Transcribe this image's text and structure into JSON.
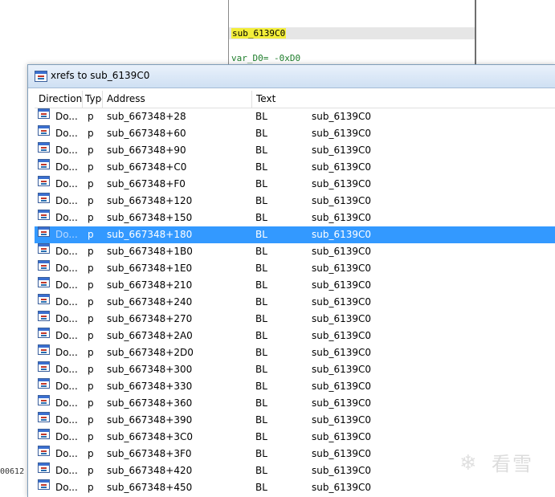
{
  "background": {
    "function_name": "sub_6139C0",
    "var_line": "var_D0= -0xD0",
    "status_text": "00612"
  },
  "window": {
    "title": "xrefs to sub_6139C0",
    "icon": "xref-window-icon"
  },
  "columns": {
    "direction": "Direction",
    "type": "Type",
    "address": "Address",
    "text": "Text"
  },
  "rows": [
    {
      "direction": "Do...",
      "type": "p",
      "address": "sub_667348+28",
      "instruction": "BL",
      "operand": "sub_6139C0"
    },
    {
      "direction": "Do...",
      "type": "p",
      "address": "sub_667348+60",
      "instruction": "BL",
      "operand": "sub_6139C0"
    },
    {
      "direction": "Do...",
      "type": "p",
      "address": "sub_667348+90",
      "instruction": "BL",
      "operand": "sub_6139C0"
    },
    {
      "direction": "Do...",
      "type": "p",
      "address": "sub_667348+C0",
      "instruction": "BL",
      "operand": "sub_6139C0"
    },
    {
      "direction": "Do...",
      "type": "p",
      "address": "sub_667348+F0",
      "instruction": "BL",
      "operand": "sub_6139C0"
    },
    {
      "direction": "Do...",
      "type": "p",
      "address": "sub_667348+120",
      "instruction": "BL",
      "operand": "sub_6139C0"
    },
    {
      "direction": "Do...",
      "type": "p",
      "address": "sub_667348+150",
      "instruction": "BL",
      "operand": "sub_6139C0"
    },
    {
      "direction": "Do...",
      "type": "p",
      "address": "sub_667348+180",
      "instruction": "BL",
      "operand": "sub_6139C0",
      "selected": true
    },
    {
      "direction": "Do...",
      "type": "p",
      "address": "sub_667348+1B0",
      "instruction": "BL",
      "operand": "sub_6139C0"
    },
    {
      "direction": "Do...",
      "type": "p",
      "address": "sub_667348+1E0",
      "instruction": "BL",
      "operand": "sub_6139C0"
    },
    {
      "direction": "Do...",
      "type": "p",
      "address": "sub_667348+210",
      "instruction": "BL",
      "operand": "sub_6139C0"
    },
    {
      "direction": "Do...",
      "type": "p",
      "address": "sub_667348+240",
      "instruction": "BL",
      "operand": "sub_6139C0"
    },
    {
      "direction": "Do...",
      "type": "p",
      "address": "sub_667348+270",
      "instruction": "BL",
      "operand": "sub_6139C0"
    },
    {
      "direction": "Do...",
      "type": "p",
      "address": "sub_667348+2A0",
      "instruction": "BL",
      "operand": "sub_6139C0"
    },
    {
      "direction": "Do...",
      "type": "p",
      "address": "sub_667348+2D0",
      "instruction": "BL",
      "operand": "sub_6139C0"
    },
    {
      "direction": "Do...",
      "type": "p",
      "address": "sub_667348+300",
      "instruction": "BL",
      "operand": "sub_6139C0"
    },
    {
      "direction": "Do...",
      "type": "p",
      "address": "sub_667348+330",
      "instruction": "BL",
      "operand": "sub_6139C0"
    },
    {
      "direction": "Do...",
      "type": "p",
      "address": "sub_667348+360",
      "instruction": "BL",
      "operand": "sub_6139C0"
    },
    {
      "direction": "Do...",
      "type": "p",
      "address": "sub_667348+390",
      "instruction": "BL",
      "operand": "sub_6139C0"
    },
    {
      "direction": "Do...",
      "type": "p",
      "address": "sub_667348+3C0",
      "instruction": "BL",
      "operand": "sub_6139C0"
    },
    {
      "direction": "Do...",
      "type": "p",
      "address": "sub_667348+3F0",
      "instruction": "BL",
      "operand": "sub_6139C0"
    },
    {
      "direction": "Do...",
      "type": "p",
      "address": "sub_667348+420",
      "instruction": "BL",
      "operand": "sub_6139C0"
    },
    {
      "direction": "Do...",
      "type": "p",
      "address": "sub_667348+450",
      "instruction": "BL",
      "operand": "sub_6139C0"
    }
  ],
  "watermark": {
    "text": "看雪",
    "icon": "snowflake-icon"
  },
  "colors": {
    "selection": "#3399ff",
    "highlight": "#f3ee3a",
    "var_text": "#1d7d2a"
  }
}
